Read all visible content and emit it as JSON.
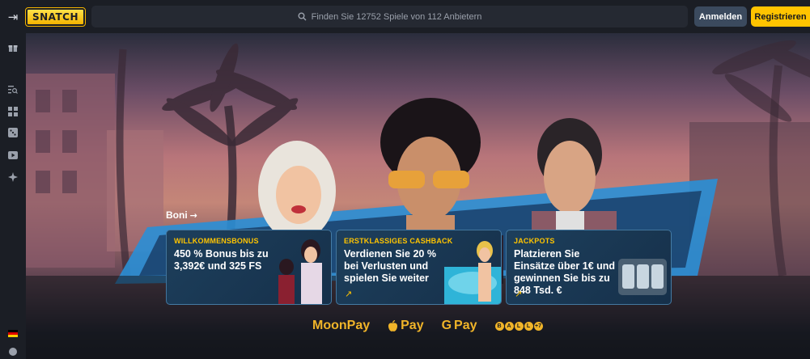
{
  "header": {
    "collapse_icon": "sidebar-collapse-icon",
    "logo_text": "SNATCH",
    "search_placeholder": "Finden Sie 12752 Spiele von 112 Anbietern",
    "login_label": "Anmelden",
    "register_label": "Registrieren"
  },
  "sidebar": {
    "icons": [
      "gift-icon",
      "search-list-icon",
      "games-grid-icon",
      "dice-icon",
      "live-play-icon",
      "sparkle-icon",
      "german-flag-icon",
      "chat-icon"
    ]
  },
  "hero": {
    "section_label": "Boni",
    "section_arrow": "→",
    "cards": [
      {
        "title": "WILLKOMMENSBONUS",
        "text": "450 % Bonus bis zu 3,392€ und 325 FS",
        "arrow": ""
      },
      {
        "title": "ERSTKLASSIGES CASHBACK",
        "text": "Verdienen Sie 20 % bei Verlusten und spielen Sie weiter",
        "arrow": "↗"
      },
      {
        "title": "JACKPOTS",
        "text": "Platzieren Sie Einsätze über 1€ und gewinnen Sie bis zu 848 Tsd. €",
        "arrow": "↗"
      }
    ]
  },
  "payments": {
    "moonpay": "MoonPay",
    "applepay": "Pay",
    "gpay": "Pay",
    "gpay_g": "G",
    "apple_glyph": "",
    "balls": [
      "B",
      "A",
      "L",
      "L",
      "+"
    ],
    "balls_extra": "+7"
  },
  "colors": {
    "accent": "#ffc400",
    "login_bg": "#3b4a5e",
    "topbar_bg": "#1b1e25"
  }
}
